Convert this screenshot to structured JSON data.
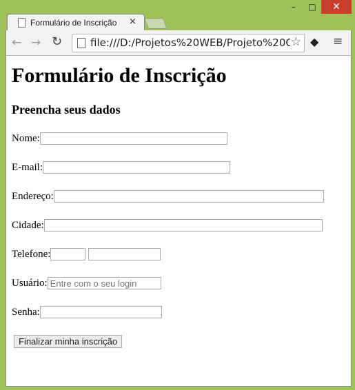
{
  "window": {
    "controls": {
      "minimize": "–",
      "maximize": "□",
      "close": "✕"
    }
  },
  "tab": {
    "title": "Formulário de Inscrição",
    "close": "×"
  },
  "toolbar": {
    "back": "←",
    "forward": "→",
    "reload": "↻",
    "url": "file:///D:/Projetos%20WEB/Projeto%20Cu",
    "star": "☆",
    "extension": "◆",
    "menu": "≡"
  },
  "page": {
    "heading": "Formulário de Inscrição",
    "subheading": "Preencha seus dados",
    "fields": {
      "nome": {
        "label": "Nome:",
        "value": ""
      },
      "email": {
        "label": "E-mail:",
        "value": ""
      },
      "endereco": {
        "label": "Endereço:",
        "value": ""
      },
      "cidade": {
        "label": "Cidade:",
        "value": ""
      },
      "telefone": {
        "label": "Telefone:",
        "ddd": "",
        "numero": ""
      },
      "usuario": {
        "label": "Usuário:",
        "placeholder": "Entre com o seu login"
      },
      "senha": {
        "label": "Senha:",
        "value": ""
      }
    },
    "submit": "Finalizar minha inscrição"
  }
}
